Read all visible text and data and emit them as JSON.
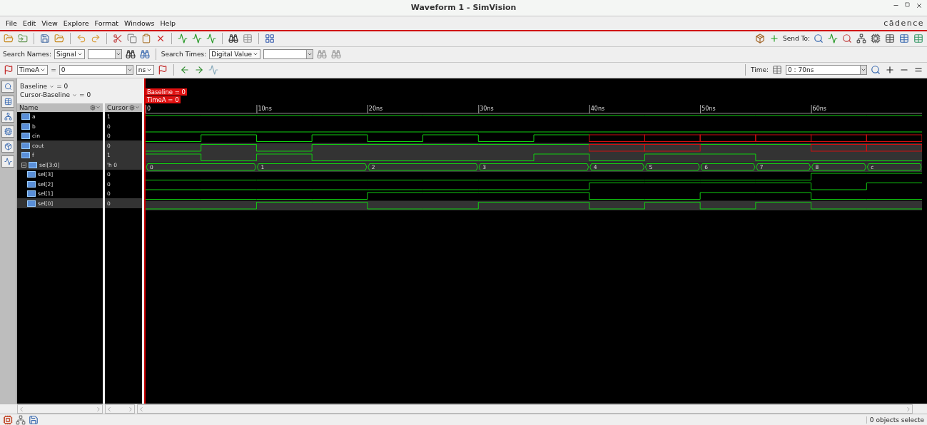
{
  "window": {
    "title": "Waveform 1 - SimVision",
    "logo": "cādence"
  },
  "menu": [
    "File",
    "Edit",
    "View",
    "Explore",
    "Format",
    "Windows",
    "Help"
  ],
  "search_bar": {
    "names_label": "Search Names:",
    "names_type": "Signal",
    "times_label": "Search Times:",
    "times_type": "Digital Value"
  },
  "send_to": "Send To:",
  "cursor_bar": {
    "cursor": "TimeA",
    "equals": "=",
    "value": "0",
    "unit": "ns",
    "time_label": "Time:",
    "time_range": "0 : 70ns"
  },
  "baseline": {
    "baseline": "Baseline",
    "baseline_value": "= 0",
    "cursor_baseline": "Cursor-Baseline",
    "cursor_baseline_value": "= 0"
  },
  "columns": [
    "Name",
    "Cursor"
  ],
  "markers": [
    "Baseline = 0",
    "TimeA = 0"
  ],
  "axis": {
    "ticks": [
      "0",
      "10ns",
      "20ns",
      "30ns",
      "40ns",
      "50ns",
      "60ns"
    ]
  },
  "signals": [
    {
      "name": "a",
      "kind": "bit",
      "cursor": "1",
      "selected": false,
      "wave": [
        {
          "kind": "high"
        },
        {
          "kind": "high"
        },
        {
          "kind": "high"
        },
        {
          "kind": "high"
        },
        {
          "kind": "high"
        },
        {
          "kind": "high"
        },
        {
          "kind": "high"
        },
        {
          "kind": "high"
        },
        {
          "kind": "high"
        },
        {
          "kind": "high"
        },
        {
          "kind": "high"
        },
        {
          "kind": "high"
        },
        {
          "kind": "high"
        },
        {
          "kind": "high"
        }
      ]
    },
    {
      "name": "b",
      "kind": "bit",
      "cursor": "0",
      "selected": false,
      "wave": [
        {
          "kind": "low"
        },
        {
          "kind": "low"
        },
        {
          "kind": "low"
        },
        {
          "kind": "low"
        },
        {
          "kind": "low"
        },
        {
          "kind": "low"
        },
        {
          "kind": "low"
        },
        {
          "kind": "low"
        },
        {
          "kind": "low"
        },
        {
          "kind": "low"
        },
        {
          "kind": "low"
        },
        {
          "kind": "low"
        },
        {
          "kind": "low"
        },
        {
          "kind": "low"
        }
      ]
    },
    {
      "name": "cin",
      "kind": "bit",
      "cursor": "0",
      "selected": false,
      "wave": [
        {
          "kind": "low"
        },
        {
          "kind": "high"
        },
        {
          "kind": "low"
        },
        {
          "kind": "high"
        },
        {
          "kind": "low"
        },
        {
          "kind": "high"
        },
        {
          "kind": "low"
        },
        {
          "kind": "high"
        },
        {
          "kind": "unknown"
        },
        {
          "kind": "unknown"
        },
        {
          "kind": "unknown"
        },
        {
          "kind": "unknown"
        },
        {
          "kind": "unknown"
        },
        {
          "kind": "unknown"
        }
      ]
    },
    {
      "name": "cout",
      "kind": "bit",
      "cursor": "0",
      "selected": true,
      "wave": [
        {
          "kind": "low"
        },
        {
          "kind": "high"
        },
        {
          "kind": "low"
        },
        {
          "kind": "high"
        },
        {
          "kind": "high"
        },
        {
          "kind": "high"
        },
        {
          "kind": "high"
        },
        {
          "kind": "high"
        },
        {
          "kind": "unknown"
        },
        {
          "kind": "unknown"
        },
        {
          "kind": "high"
        },
        {
          "kind": "high"
        },
        {
          "kind": "unknown"
        },
        {
          "kind": "unknown"
        }
      ]
    },
    {
      "name": "f",
      "kind": "bit",
      "cursor": "1",
      "selected": true,
      "wave": [
        {
          "kind": "high"
        },
        {
          "kind": "low"
        },
        {
          "kind": "high"
        },
        {
          "kind": "low"
        },
        {
          "kind": "low"
        },
        {
          "kind": "low"
        },
        {
          "kind": "low"
        },
        {
          "kind": "high"
        },
        {
          "kind": "low"
        },
        {
          "kind": "high"
        },
        {
          "kind": "high"
        },
        {
          "kind": "low"
        },
        {
          "kind": "low"
        },
        {
          "kind": "low"
        }
      ]
    },
    {
      "name": "sel[3:0]",
      "kind": "bus",
      "cursor": "'h 0",
      "selected": true,
      "expanded": true,
      "wave": [
        {
          "kind": "start",
          "value": "0"
        },
        {
          "kind": "hold"
        },
        {
          "kind": "start",
          "value": "1"
        },
        {
          "kind": "hold"
        },
        {
          "kind": "start",
          "value": "2"
        },
        {
          "kind": "hold"
        },
        {
          "kind": "start",
          "value": "3"
        },
        {
          "kind": "hold"
        },
        {
          "kind": "start",
          "value": "4"
        },
        {
          "kind": "start",
          "value": "5"
        },
        {
          "kind": "start",
          "value": "6"
        },
        {
          "kind": "start",
          "value": "7"
        },
        {
          "kind": "start",
          "value": "8"
        },
        {
          "kind": "start",
          "value": "c"
        }
      ],
      "children": [
        {
          "name": "sel[3]",
          "kind": "bit",
          "cursor": "0",
          "selected": false,
          "wave": [
            {
              "kind": "low"
            },
            {
              "kind": "low"
            },
            {
              "kind": "low"
            },
            {
              "kind": "low"
            },
            {
              "kind": "low"
            },
            {
              "kind": "low"
            },
            {
              "kind": "low"
            },
            {
              "kind": "low"
            },
            {
              "kind": "low"
            },
            {
              "kind": "low"
            },
            {
              "kind": "low"
            },
            {
              "kind": "low"
            },
            {
              "kind": "high"
            },
            {
              "kind": "high"
            }
          ]
        },
        {
          "name": "sel[2]",
          "kind": "bit",
          "cursor": "0",
          "selected": false,
          "wave": [
            {
              "kind": "low"
            },
            {
              "kind": "low"
            },
            {
              "kind": "low"
            },
            {
              "kind": "low"
            },
            {
              "kind": "low"
            },
            {
              "kind": "low"
            },
            {
              "kind": "low"
            },
            {
              "kind": "low"
            },
            {
              "kind": "high"
            },
            {
              "kind": "high"
            },
            {
              "kind": "high"
            },
            {
              "kind": "high"
            },
            {
              "kind": "low"
            },
            {
              "kind": "high"
            }
          ]
        },
        {
          "name": "sel[1]",
          "kind": "bit",
          "cursor": "0",
          "selected": false,
          "wave": [
            {
              "kind": "low"
            },
            {
              "kind": "low"
            },
            {
              "kind": "low"
            },
            {
              "kind": "low"
            },
            {
              "kind": "high"
            },
            {
              "kind": "high"
            },
            {
              "kind": "high"
            },
            {
              "kind": "high"
            },
            {
              "kind": "low"
            },
            {
              "kind": "low"
            },
            {
              "kind": "high"
            },
            {
              "kind": "high"
            },
            {
              "kind": "low"
            },
            {
              "kind": "low"
            }
          ]
        },
        {
          "name": "sel[0]",
          "kind": "bit",
          "cursor": "0",
          "selected": true,
          "wave": [
            {
              "kind": "low"
            },
            {
              "kind": "low"
            },
            {
              "kind": "high"
            },
            {
              "kind": "high"
            },
            {
              "kind": "low"
            },
            {
              "kind": "low"
            },
            {
              "kind": "high"
            },
            {
              "kind": "high"
            },
            {
              "kind": "low"
            },
            {
              "kind": "high"
            },
            {
              "kind": "low"
            },
            {
              "kind": "high"
            },
            {
              "kind": "low"
            },
            {
              "kind": "low"
            }
          ]
        }
      ]
    }
  ],
  "status_bar": {
    "text": "0 objects selecte"
  }
}
